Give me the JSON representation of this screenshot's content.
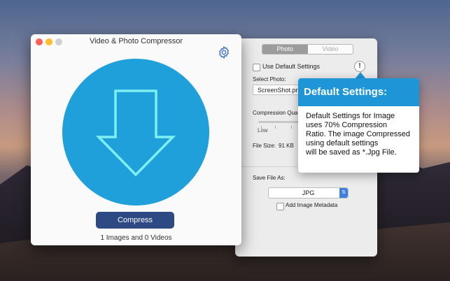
{
  "main_window": {
    "title": "Video & Photo Compressor",
    "compress_label": "Compress",
    "status": "1 Images and 0 Videos"
  },
  "settings_panel": {
    "tabs": [
      {
        "label": "Photo",
        "selected": true
      },
      {
        "label": "Video",
        "selected": false
      }
    ],
    "use_default_label": "Use Default Settings",
    "info_label": "!",
    "select_photo_label": "Select Photo:",
    "selected_photo": "ScreenShot.png",
    "compression_label": "Compression Qua",
    "slider_low_label": "Low",
    "file_size_label": "File Size:",
    "file_size_value": "91 KB",
    "save_file_label": "Save File As:",
    "format_value": "JPG",
    "metadata_label": "Add Image Metadata"
  },
  "popover": {
    "heading": "Default Settings:",
    "lines": [
      "Default Settings for Image",
      "uses 70% Compression",
      "Ratio. The image Compressed",
      "using default settings",
      "will be saved as *.Jpg File."
    ]
  },
  "colors": {
    "accent": "#1fa0da",
    "button": "#2d4a85",
    "popover_header": "#1d95d6",
    "close": "#fc5f57",
    "minimize": "#fdbc2e",
    "zoom": "#d0d0d0"
  },
  "icons": [
    "gear-icon",
    "download-arrow-icon",
    "info-icon",
    "chevron-updown-icon"
  ]
}
